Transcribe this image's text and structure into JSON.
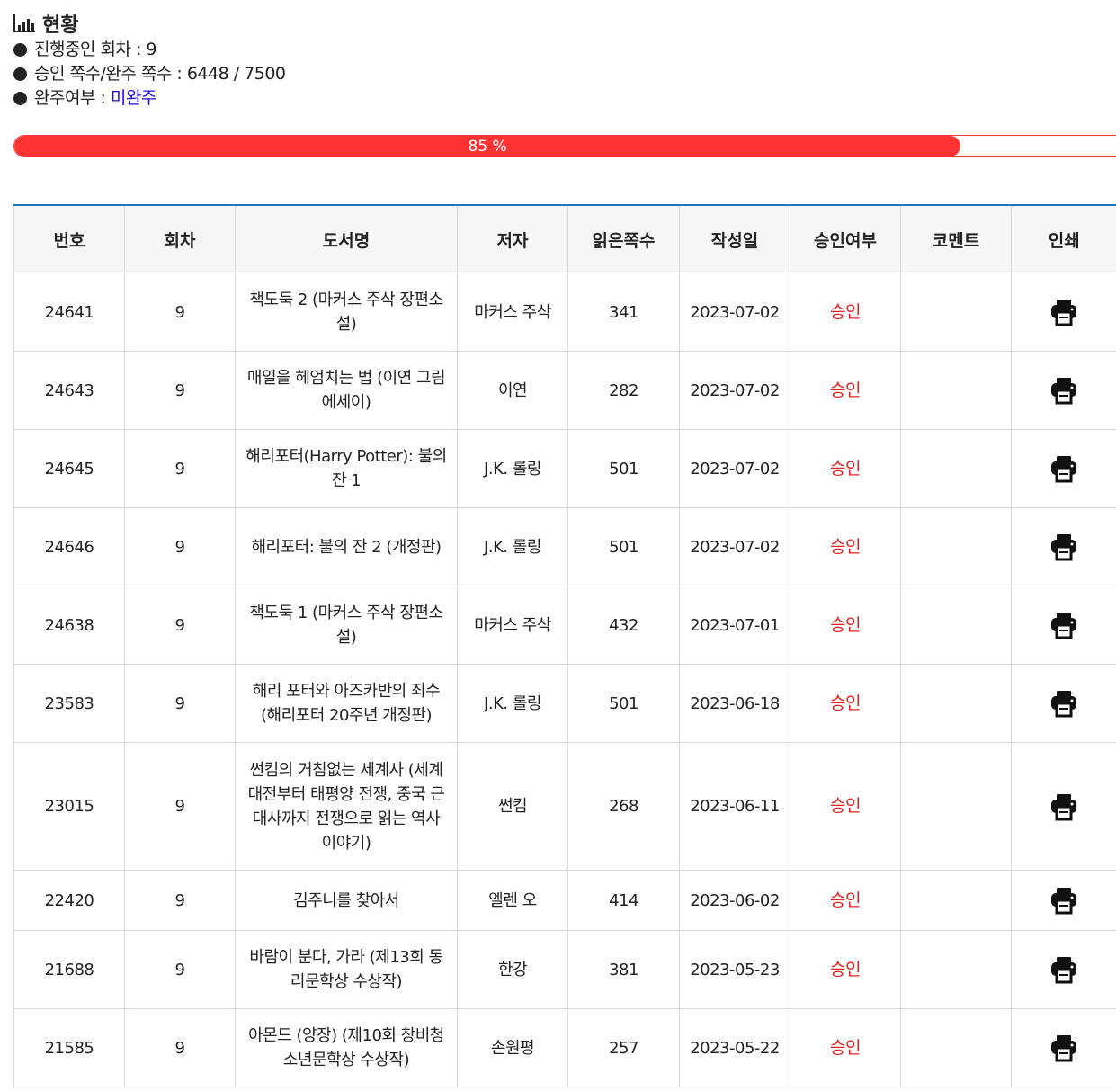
{
  "status": {
    "title": "현황",
    "lines": [
      {
        "label": "진행중인 회차 : ",
        "value": "9"
      },
      {
        "label": "승인 쪽수/완주 쪽수 : ",
        "value": "6448 / 7500"
      },
      {
        "label": "완주여부 : ",
        "value": "미완주"
      }
    ]
  },
  "progress": {
    "percent": 85,
    "label": "85 %",
    "color": "#ff3333"
  },
  "table": {
    "headers": [
      "번호",
      "회차",
      "도서명",
      "저자",
      "읽은쪽수",
      "작성일",
      "승인여부",
      "코멘트",
      "인쇄"
    ],
    "rows": [
      {
        "no": "24641",
        "round": "9",
        "title": "책도둑 2 (마커스 주삭 장편소설)",
        "author": "마커스 주삭",
        "pages": "341",
        "date": "2023-07-02",
        "status": "승인",
        "comment": ""
      },
      {
        "no": "24643",
        "round": "9",
        "title": "매일을 헤엄치는 법 (이연 그림 에세이)",
        "author": "이연",
        "pages": "282",
        "date": "2023-07-02",
        "status": "승인",
        "comment": ""
      },
      {
        "no": "24645",
        "round": "9",
        "title": "해리포터(Harry Potter): 불의 잔 1",
        "author": "J.K. 롤링",
        "pages": "501",
        "date": "2023-07-02",
        "status": "승인",
        "comment": ""
      },
      {
        "no": "24646",
        "round": "9",
        "title": "해리포터: 불의 잔 2 (개정판)",
        "author": "J.K. 롤링",
        "pages": "501",
        "date": "2023-07-02",
        "status": "승인",
        "comment": ""
      },
      {
        "no": "24638",
        "round": "9",
        "title": "책도둑 1 (마커스 주삭 장편소설)",
        "author": "마커스 주삭",
        "pages": "432",
        "date": "2023-07-01",
        "status": "승인",
        "comment": ""
      },
      {
        "no": "23583",
        "round": "9",
        "title": "해리 포터와 아즈카반의 죄수(해리포터 20주년 개정판)",
        "author": "J.K. 롤링",
        "pages": "501",
        "date": "2023-06-18",
        "status": "승인",
        "comment": ""
      },
      {
        "no": "23015",
        "round": "9",
        "title": "썬킴의 거침없는 세계사 (세계대전부터 태평양 전쟁, 중국 근대사까지 전쟁으로 읽는 역사 이야기)",
        "author": "썬킴",
        "pages": "268",
        "date": "2023-06-11",
        "status": "승인",
        "comment": ""
      },
      {
        "no": "22420",
        "round": "9",
        "title": "김주니를 찾아서",
        "author": "엘렌 오",
        "pages": "414",
        "date": "2023-06-02",
        "status": "승인",
        "comment": ""
      },
      {
        "no": "21688",
        "round": "9",
        "title": "바람이 분다, 가라 (제13회 동리문학상 수상작)",
        "author": "한강",
        "pages": "381",
        "date": "2023-05-23",
        "status": "승인",
        "comment": ""
      },
      {
        "no": "21585",
        "round": "9",
        "title": "아몬드 (양장) (제10회 창비청소년문학상 수상작)",
        "author": "손원평",
        "pages": "257",
        "date": "2023-05-22",
        "status": "승인",
        "comment": ""
      }
    ]
  },
  "icons": {
    "print": "printer-icon",
    "chart": "bar-chart-icon",
    "bullet": "bullet-dot"
  },
  "colors": {
    "approved": "#e52222",
    "link": "#1a0dd6",
    "accent": "#1e7ab8"
  }
}
